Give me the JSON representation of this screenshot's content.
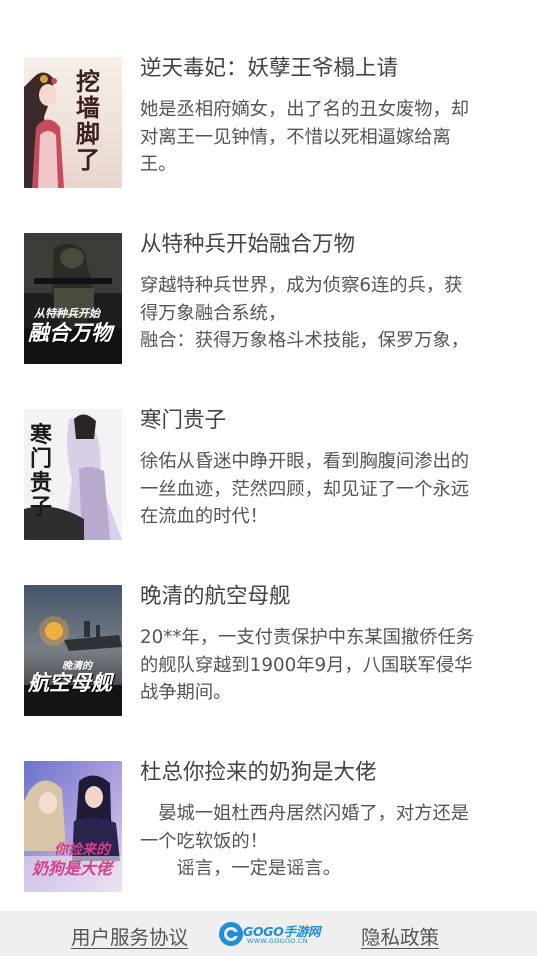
{
  "books": [
    {
      "title": "逆天毒妃：妖孽王爷榻上请",
      "desc_lines": [
        "她是丞相府嫡女，出了名的丑女废物，却",
        "对离王一见钟情，不惜以死相逼嫁给离",
        "王。"
      ],
      "cover_text": "挖墙脚了"
    },
    {
      "title": "从特种兵开始融合万物",
      "desc_lines": [
        "穿越特种兵世界，成为侦察6连的兵，获",
        "得万象融合系统，",
        "融合：获得万象格斗术技能，保罗万象，"
      ],
      "cover_text": "融合万物",
      "cover_subtext": "从特种兵开始"
    },
    {
      "title": "寒门贵子",
      "desc_lines": [
        "徐佑从昏迷中睁开眼，看到胸腹间渗出的",
        "一丝血迹，茫然四顾，却见证了一个永远",
        "在流血的时代！"
      ],
      "cover_text": "寒门贵子"
    },
    {
      "title": "晚清的航空母舰",
      "desc_lines": [
        "20**年，一支付责保护中东某国撤侨任务",
        "的舰队穿越到1900年9月，八国联军侵华",
        "战争期间。"
      ],
      "cover_text": "航空母舰",
      "cover_subtext": "晚清的"
    },
    {
      "title": "杜总你捡来的奶狗是大佬",
      "desc_lines": [
        "　晏城一姐杜西舟居然闪婚了，对方还是",
        "一个吃软饭的！",
        "　　谣言，一定是谣言。"
      ],
      "cover_text": "奶狗是大佬",
      "cover_subtext": "你捡来的"
    }
  ],
  "footer": {
    "user_agreement": "用户服务协议",
    "logo_text": "GOGO手游网",
    "logo_sub": "WWW.GOGOO.CN",
    "privacy_policy": "隐私政策"
  }
}
